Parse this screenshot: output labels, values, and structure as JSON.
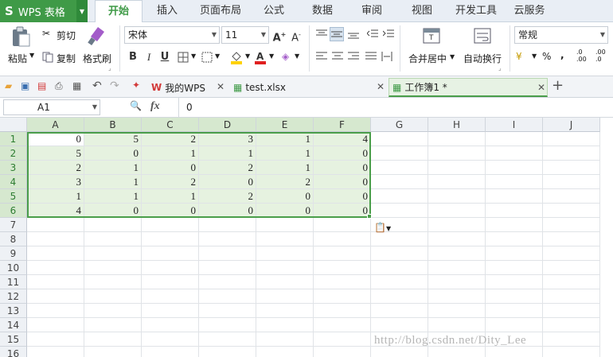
{
  "app": {
    "name": "WPS 表格",
    "logo": "S"
  },
  "ribbon_tabs": [
    "开始",
    "插入",
    "页面布局",
    "公式",
    "数据",
    "审阅",
    "视图",
    "开发工具",
    "云服务"
  ],
  "ribbon_tab_active_index": 0,
  "clipboard": {
    "paste": "粘贴",
    "cut": "剪切",
    "copy": "复制",
    "format_painter": "格式刷"
  },
  "font": {
    "family": "宋体",
    "size": "11"
  },
  "format_buttons": {
    "bold": "B",
    "italic": "I",
    "underline": "U"
  },
  "alignment": {
    "merge_center": "合并居中",
    "wrap_text": "自动换行"
  },
  "number": {
    "format": "常规",
    "percent": "%",
    "comma": ","
  },
  "doc_tabs": [
    {
      "label": "我的WPS",
      "icon": "wps-icon"
    },
    {
      "label": "test.xlsx",
      "icon": "spreadsheet-icon"
    },
    {
      "label": "工作簿1 *",
      "icon": "spreadsheet-icon",
      "active": true
    }
  ],
  "formula_bar": {
    "name_box": "A1",
    "fx": "fx",
    "value": "0"
  },
  "columns": [
    "A",
    "B",
    "C",
    "D",
    "E",
    "F",
    "G",
    "H",
    "I",
    "J"
  ],
  "rows": [
    "1",
    "2",
    "3",
    "4",
    "5",
    "6",
    "7",
    "8",
    "9",
    "10",
    "11",
    "12",
    "13",
    "14",
    "15",
    "16"
  ],
  "cells": [
    [
      "0",
      "5",
      "2",
      "3",
      "1",
      "4"
    ],
    [
      "5",
      "0",
      "1",
      "1",
      "1",
      "0"
    ],
    [
      "2",
      "1",
      "0",
      "2",
      "1",
      "0"
    ],
    [
      "3",
      "1",
      "2",
      "0",
      "2",
      "0"
    ],
    [
      "1",
      "1",
      "1",
      "2",
      "0",
      "0"
    ],
    [
      "4",
      "0",
      "0",
      "0",
      "0",
      "0"
    ]
  ],
  "selection": "A1:F6",
  "watermark": "http://blog.csdn.net/Dity_Lee",
  "colors": {
    "brand": "#3f9a47",
    "selection_fill": "#e6f2e0",
    "selection_border": "#4a9e4a"
  }
}
